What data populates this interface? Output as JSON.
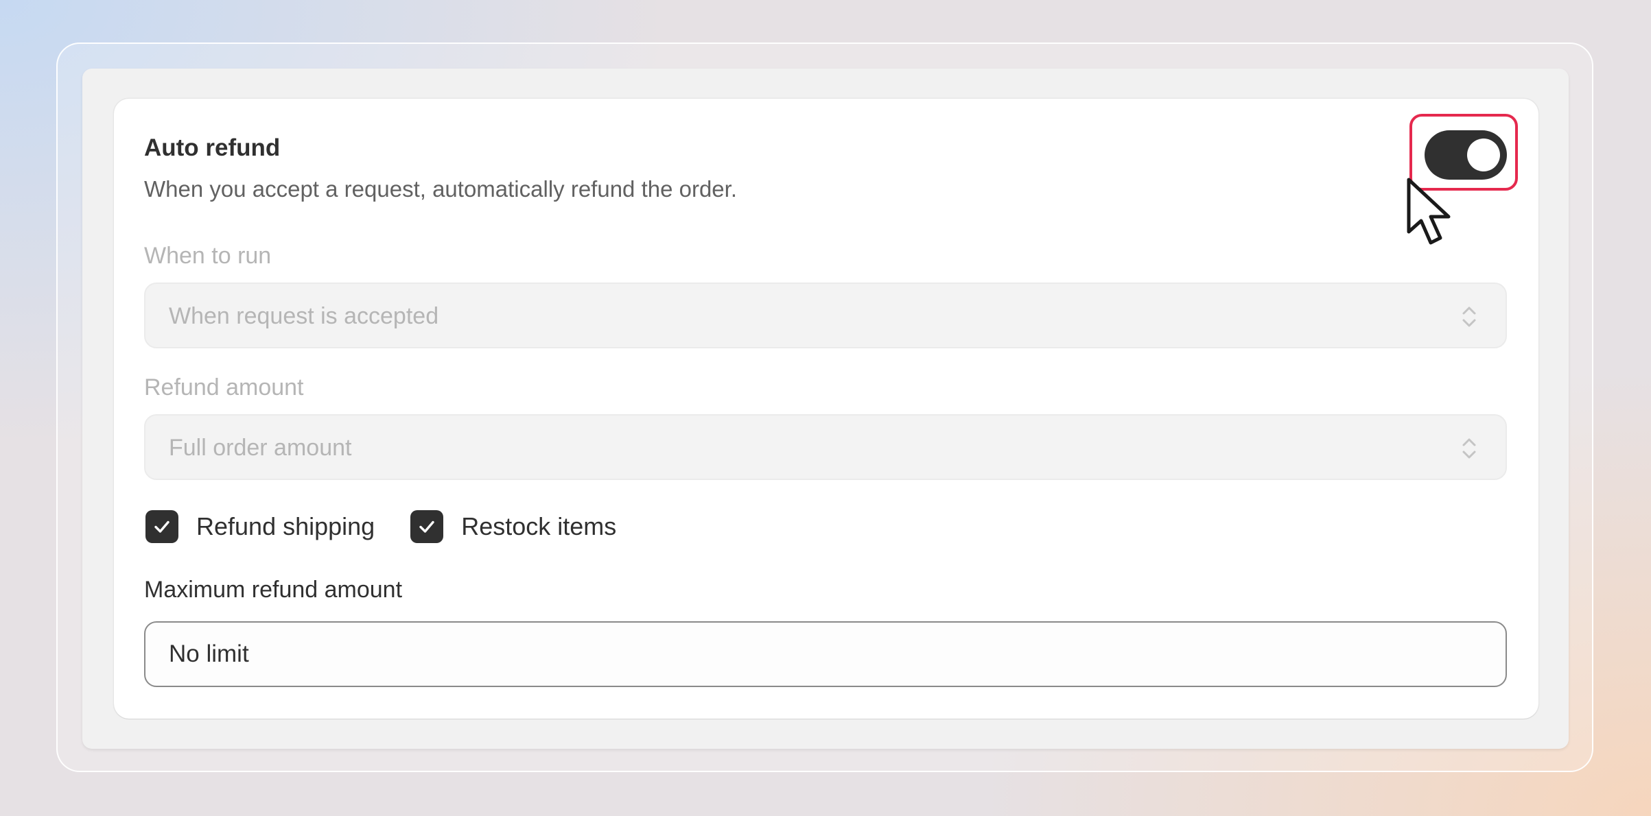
{
  "settings": {
    "auto_refund": {
      "title": "Auto refund",
      "description": "When you accept a request, automatically refund the order.",
      "enabled": true
    },
    "when_to_run": {
      "label": "When to run",
      "value": "When request is accepted"
    },
    "refund_amount": {
      "label": "Refund amount",
      "value": "Full order amount"
    },
    "checkboxes": [
      {
        "label": "Refund shipping",
        "checked": true
      },
      {
        "label": "Restock items",
        "checked": true
      }
    ],
    "max_refund": {
      "label": "Maximum refund amount",
      "value": "No limit"
    }
  },
  "icons": {
    "toggle": "toggle-switch-icon",
    "select_arrows": "chevron-up-down-icon",
    "checkbox": "checkmark-icon",
    "cursor": "mouse-pointer-icon"
  },
  "colors": {
    "accent_dark": "#303030",
    "highlight": "#e5294e",
    "muted_text": "#b5b5b5",
    "secondary_text": "#616161"
  }
}
